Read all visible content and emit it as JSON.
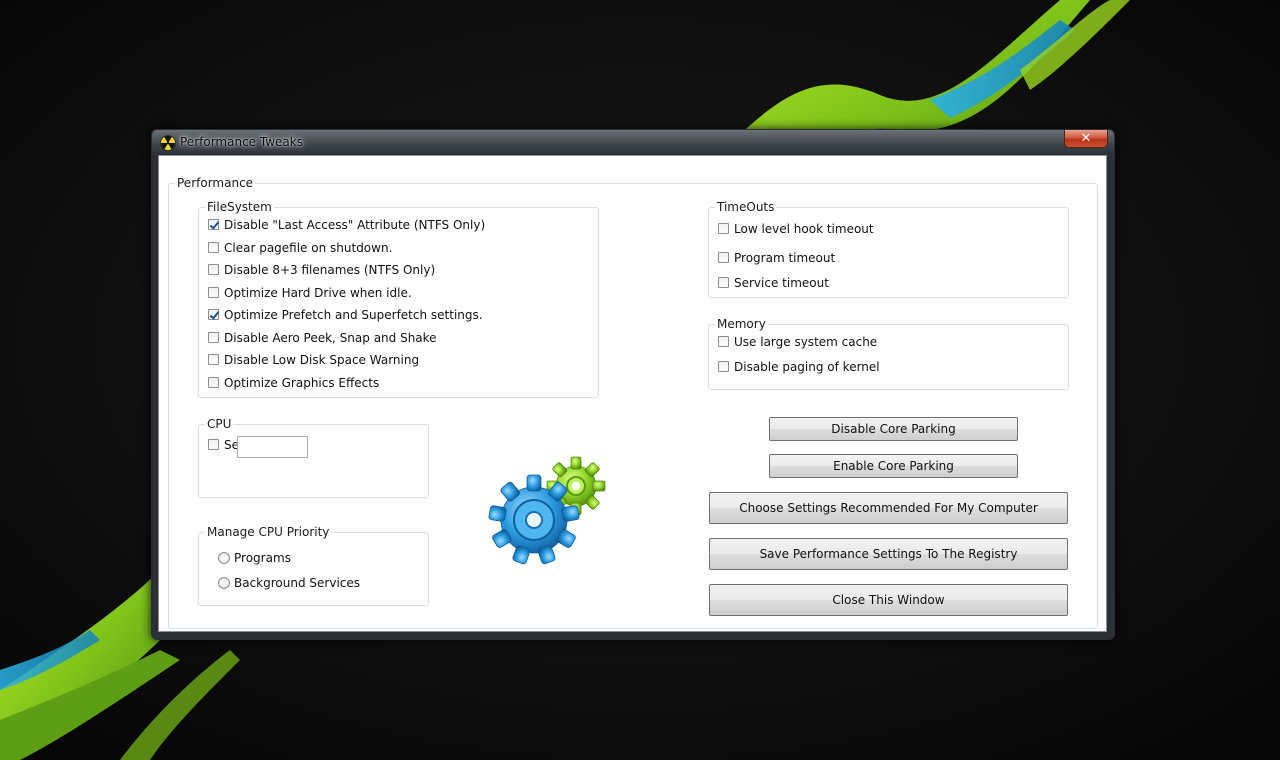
{
  "window": {
    "title": "Performance Tweaks",
    "close_label": "✕"
  },
  "performance": {
    "label": "Performance",
    "filesystem": {
      "label": "FileSystem",
      "options": [
        {
          "label": "Disable \"Last Access\" Attribute (NTFS Only)",
          "checked": true
        },
        {
          "label": "Clear pagefile on shutdown.",
          "checked": false
        },
        {
          "label": "Disable 8+3 filenames (NTFS Only)",
          "checked": false
        },
        {
          "label": "Optimize Hard Drive when idle.",
          "checked": false
        },
        {
          "label": "Optimize Prefetch and Superfetch settings.",
          "checked": true
        },
        {
          "label": "Disable Aero Peek, Snap and Shake",
          "checked": false
        },
        {
          "label": "Disable Low Disk Space Warning",
          "checked": false
        },
        {
          "label": "Optimize Graphics Effects",
          "checked": false
        }
      ]
    },
    "cpu": {
      "label": "CPU",
      "set_l2": {
        "label": "Set L2 Cache",
        "checked": false
      },
      "l2_value": ""
    },
    "priority": {
      "label": "Manage CPU Priority",
      "options": [
        {
          "label": "Programs",
          "selected": false
        },
        {
          "label": "Background Services",
          "selected": false
        }
      ]
    },
    "timeouts": {
      "label": "TimeOuts",
      "options": [
        {
          "label": "Low level hook timeout",
          "checked": false
        },
        {
          "label": "Program timeout",
          "checked": false
        },
        {
          "label": "Service timeout",
          "checked": false
        }
      ]
    },
    "memory": {
      "label": "Memory",
      "options": [
        {
          "label": "Use large system cache",
          "checked": false
        },
        {
          "label": "Disable paging of kernel",
          "checked": false
        }
      ]
    },
    "buttons": {
      "disable_core_parking": "Disable Core Parking",
      "enable_core_parking": "Enable Core Parking",
      "recommended": "Choose Settings Recommended For My Computer",
      "save_registry": "Save Performance Settings To The Registry",
      "close_window": "Close This Window"
    }
  },
  "icons": {
    "app": "radiation-icon",
    "gears": "gears-icon"
  },
  "colors": {
    "wallpaper_bg": "#0d0d0d",
    "wallpaper_green": "#8fd11e",
    "wallpaper_blue": "#1fa3d8",
    "gear_blue": "#2a9be0",
    "gear_green": "#8fd126"
  }
}
